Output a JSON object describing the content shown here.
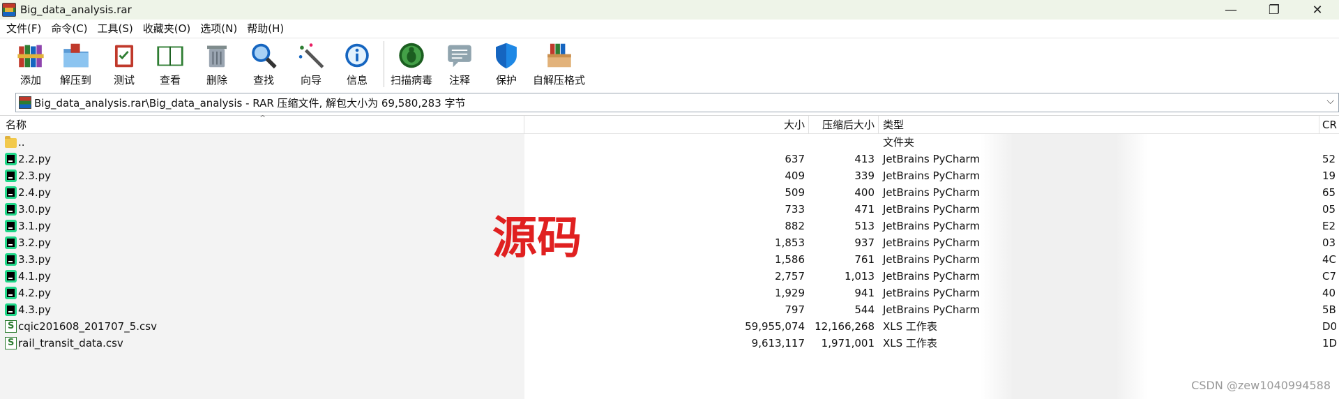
{
  "window": {
    "title": "Big_data_analysis.rar",
    "controls": [
      "—",
      "❐",
      "✕"
    ]
  },
  "menu": [
    "文件(F)",
    "命令(C)",
    "工具(S)",
    "收藏夹(O)",
    "选项(N)",
    "帮助(H)"
  ],
  "toolbar": [
    {
      "label": "添加",
      "icon": "add-books-icon"
    },
    {
      "label": "解压到",
      "icon": "extract-folder-icon"
    },
    {
      "label": "测试",
      "icon": "test-clipboard-icon"
    },
    {
      "label": "查看",
      "icon": "view-book-icon"
    },
    {
      "label": "删除",
      "icon": "trash-icon"
    },
    {
      "label": "查找",
      "icon": "magnifier-icon"
    },
    {
      "label": "向导",
      "icon": "wizard-wand-icon"
    },
    {
      "label": "信息",
      "icon": "info-icon"
    },
    {
      "label": "扫描病毒",
      "icon": "virus-scan-icon"
    },
    {
      "label": "注释",
      "icon": "comment-icon"
    },
    {
      "label": "保护",
      "icon": "shield-icon"
    },
    {
      "label": "自解压格式",
      "icon": "sfx-box-icon"
    }
  ],
  "address": {
    "path": "Big_data_analysis.rar\\Big_data_analysis - RAR 压缩文件, 解包大小为 69,580,283 字节"
  },
  "columns": {
    "name": "名称",
    "size": "大小",
    "packed": "压缩后大小",
    "type": "类型",
    "crc": "CR"
  },
  "files": [
    {
      "name": "..",
      "size": "",
      "packed": "",
      "type": "文件夹",
      "crc": "",
      "kind": "folder"
    },
    {
      "name": "2.2.py",
      "size": "637",
      "packed": "413",
      "type": "JetBrains PyCharm",
      "crc": "52",
      "kind": "py"
    },
    {
      "name": "2.3.py",
      "size": "409",
      "packed": "339",
      "type": "JetBrains PyCharm",
      "crc": "19",
      "kind": "py"
    },
    {
      "name": "2.4.py",
      "size": "509",
      "packed": "400",
      "type": "JetBrains PyCharm",
      "crc": "65",
      "kind": "py"
    },
    {
      "name": "3.0.py",
      "size": "733",
      "packed": "471",
      "type": "JetBrains PyCharm",
      "crc": "05",
      "kind": "py"
    },
    {
      "name": "3.1.py",
      "size": "882",
      "packed": "513",
      "type": "JetBrains PyCharm",
      "crc": "E2",
      "kind": "py"
    },
    {
      "name": "3.2.py",
      "size": "1,853",
      "packed": "937",
      "type": "JetBrains PyCharm",
      "crc": "03",
      "kind": "py"
    },
    {
      "name": "3.3.py",
      "size": "1,586",
      "packed": "761",
      "type": "JetBrains PyCharm",
      "crc": "4C",
      "kind": "py"
    },
    {
      "name": "4.1.py",
      "size": "2,757",
      "packed": "1,013",
      "type": "JetBrains PyCharm",
      "crc": "C7",
      "kind": "py"
    },
    {
      "name": "4.2.py",
      "size": "1,929",
      "packed": "941",
      "type": "JetBrains PyCharm",
      "crc": "40",
      "kind": "py"
    },
    {
      "name": "4.3.py",
      "size": "797",
      "packed": "544",
      "type": "JetBrains PyCharm",
      "crc": "5B",
      "kind": "py"
    },
    {
      "name": "cqic201608_201707_5.csv",
      "size": "59,955,074",
      "packed": "12,166,268",
      "type": "XLS 工作表",
      "crc": "D0",
      "kind": "csv"
    },
    {
      "name": "rail_transit_data.csv",
      "size": "9,613,117",
      "packed": "1,971,001",
      "type": "XLS 工作表",
      "crc": "1D",
      "kind": "csv"
    }
  ],
  "overlay": {
    "watermark_text": "源码",
    "csdn_text": "CSDN @zew1040994588"
  },
  "colors": {
    "titlebar_bg": "#eef4e8",
    "watermark": "#e02020",
    "pycharm_green": "#21d789"
  }
}
